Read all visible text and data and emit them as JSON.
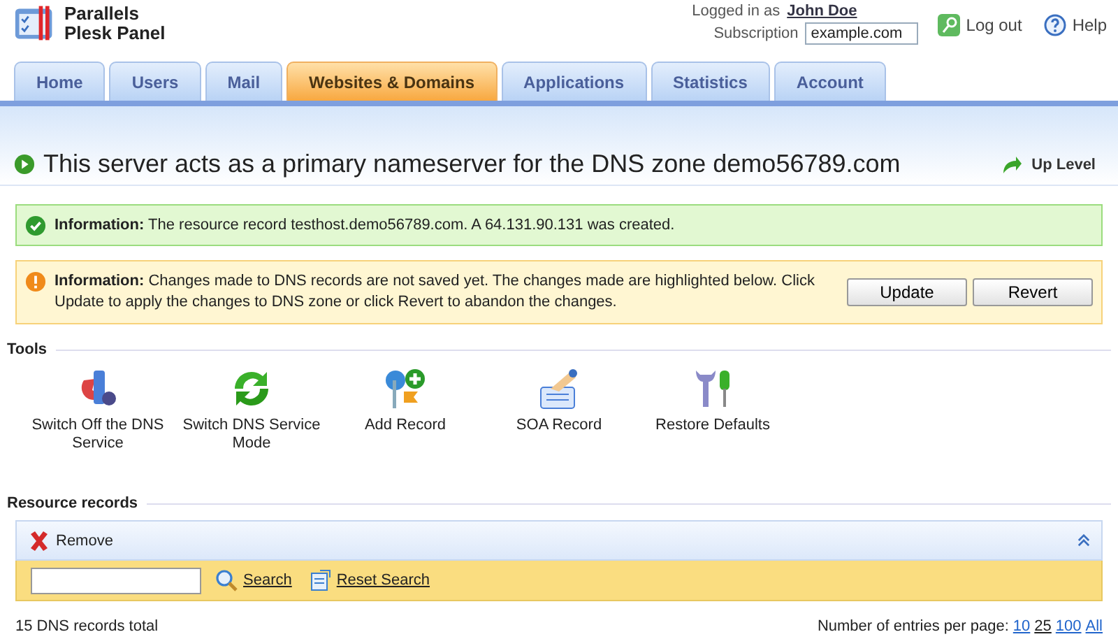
{
  "header": {
    "brand_line_1": "Parallels",
    "brand_line_2": "Plesk Panel",
    "logged_in_label": "Logged in as",
    "user": "John Doe",
    "subscription_label": "Subscription",
    "subscription": "example.com",
    "logout": "Log out",
    "help": "Help"
  },
  "tabs": [
    {
      "label": "Home",
      "selected": false
    },
    {
      "label": "Users",
      "selected": false
    },
    {
      "label": "Mail",
      "selected": false
    },
    {
      "label": "Websites & Domains",
      "selected": true
    },
    {
      "label": "Applications",
      "selected": false
    },
    {
      "label": "Statistics",
      "selected": false
    },
    {
      "label": "Account",
      "selected": false
    }
  ],
  "page_title": "This server acts as a primary nameserver for the DNS zone demo56789.com",
  "up_level": "Up Level",
  "messages": [
    {
      "kind": "success",
      "label": "Information:",
      "text": "The resource record testhost.demo56789.com. A 64.131.90.131 was created."
    },
    {
      "kind": "warning",
      "label": "Information:",
      "text": "Changes made to DNS records are not saved yet. The changes made are highlighted below. Click Update to apply the changes to DNS zone or click Revert to abandon the changes.",
      "buttons": [
        "Update",
        "Revert"
      ]
    }
  ],
  "tools": {
    "heading": "Tools",
    "items": [
      {
        "kind": "switch-off",
        "label": "Switch Off the DNS Service"
      },
      {
        "kind": "switch-mode",
        "label": "Switch DNS Service Mode"
      },
      {
        "kind": "add",
        "label": "Add Record"
      },
      {
        "kind": "soa",
        "label": "SOA Record"
      },
      {
        "kind": "restore",
        "label": "Restore Defaults"
      }
    ]
  },
  "resource_records": {
    "heading": "Resource records",
    "remove": "Remove",
    "search_link": "Search",
    "reset_search": "Reset Search",
    "total": "15 DNS records total",
    "per_page_label": "Number of entries per page:",
    "page_sizes": [
      {
        "label": "10",
        "selected": false
      },
      {
        "label": "25",
        "selected": true
      },
      {
        "label": "100",
        "selected": false
      },
      {
        "label": "All",
        "selected": false
      }
    ]
  }
}
